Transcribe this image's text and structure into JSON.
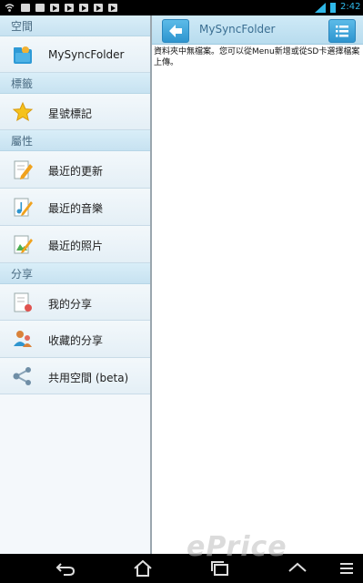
{
  "statusbar": {
    "time": "2:42"
  },
  "header": {
    "title": "MySyncFolder"
  },
  "content": {
    "empty_message": "資料夾中無檔案。您可以從Menu新增或從SD卡選擇檔案上傳。"
  },
  "sidebar": {
    "sections": [
      {
        "label": "空間",
        "items": [
          {
            "label": "MySyncFolder",
            "icon": "folder-icon"
          }
        ]
      },
      {
        "label": "標籤",
        "items": [
          {
            "label": "星號標記",
            "icon": "star-icon"
          }
        ]
      },
      {
        "label": "屬性",
        "items": [
          {
            "label": "最近的更新",
            "icon": "recent-update-icon"
          },
          {
            "label": "最近的音樂",
            "icon": "recent-music-icon"
          },
          {
            "label": "最近的照片",
            "icon": "recent-photo-icon"
          }
        ]
      },
      {
        "label": "分享",
        "items": [
          {
            "label": "我的分享",
            "icon": "my-share-icon"
          },
          {
            "label": "收藏的分享",
            "icon": "shared-collection-icon"
          },
          {
            "label": "共用空間 (beta)",
            "icon": "shared-space-icon"
          }
        ]
      }
    ]
  },
  "watermark": "ePrice",
  "colors": {
    "accent": "#2e95cf",
    "section_bg": "#cfe8f5",
    "status_time": "#2fb8e8"
  }
}
